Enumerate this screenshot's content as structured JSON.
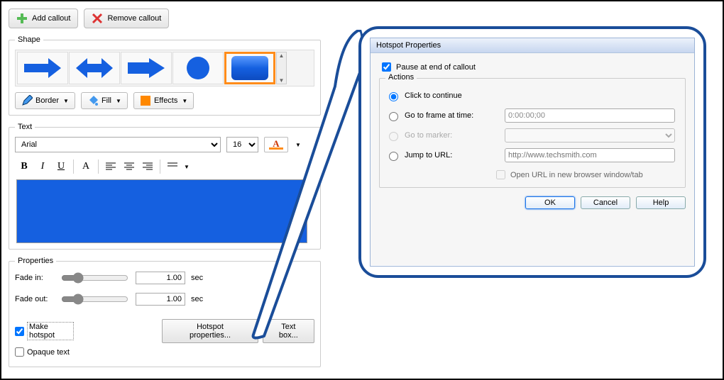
{
  "toolbar": {
    "add_label": "Add callout",
    "remove_label": "Remove callout"
  },
  "shape": {
    "legend": "Shape",
    "border_label": "Border",
    "fill_label": "Fill",
    "effects_label": "Effects"
  },
  "text": {
    "legend": "Text",
    "font": "Arial",
    "size": "16",
    "bold": "B",
    "italic": "I",
    "underline": "U",
    "font_A": "A"
  },
  "properties": {
    "legend": "Properties",
    "fade_in_label": "Fade in:",
    "fade_in_value": "1.00",
    "fade_in_unit": "sec",
    "fade_out_label": "Fade out:",
    "fade_out_value": "1.00",
    "fade_out_unit": "sec",
    "make_hotspot_label": "Make hotspot",
    "opaque_text_label": "Opaque text",
    "hotspot_btn": "Hotspot properties...",
    "textbox_btn": "Text box..."
  },
  "dialog": {
    "title": "Hotspot Properties",
    "pause_label": "Pause at end of callout",
    "actions_legend": "Actions",
    "opt_click": "Click to continue",
    "opt_frame": "Go to frame at time:",
    "frame_value": "0:00:00;00",
    "opt_marker": "Go to marker:",
    "opt_url": "Jump to URL:",
    "url_placeholder": "http://www.techsmith.com",
    "open_new": "Open URL in new browser window/tab",
    "ok": "OK",
    "cancel": "Cancel",
    "help": "Help"
  }
}
